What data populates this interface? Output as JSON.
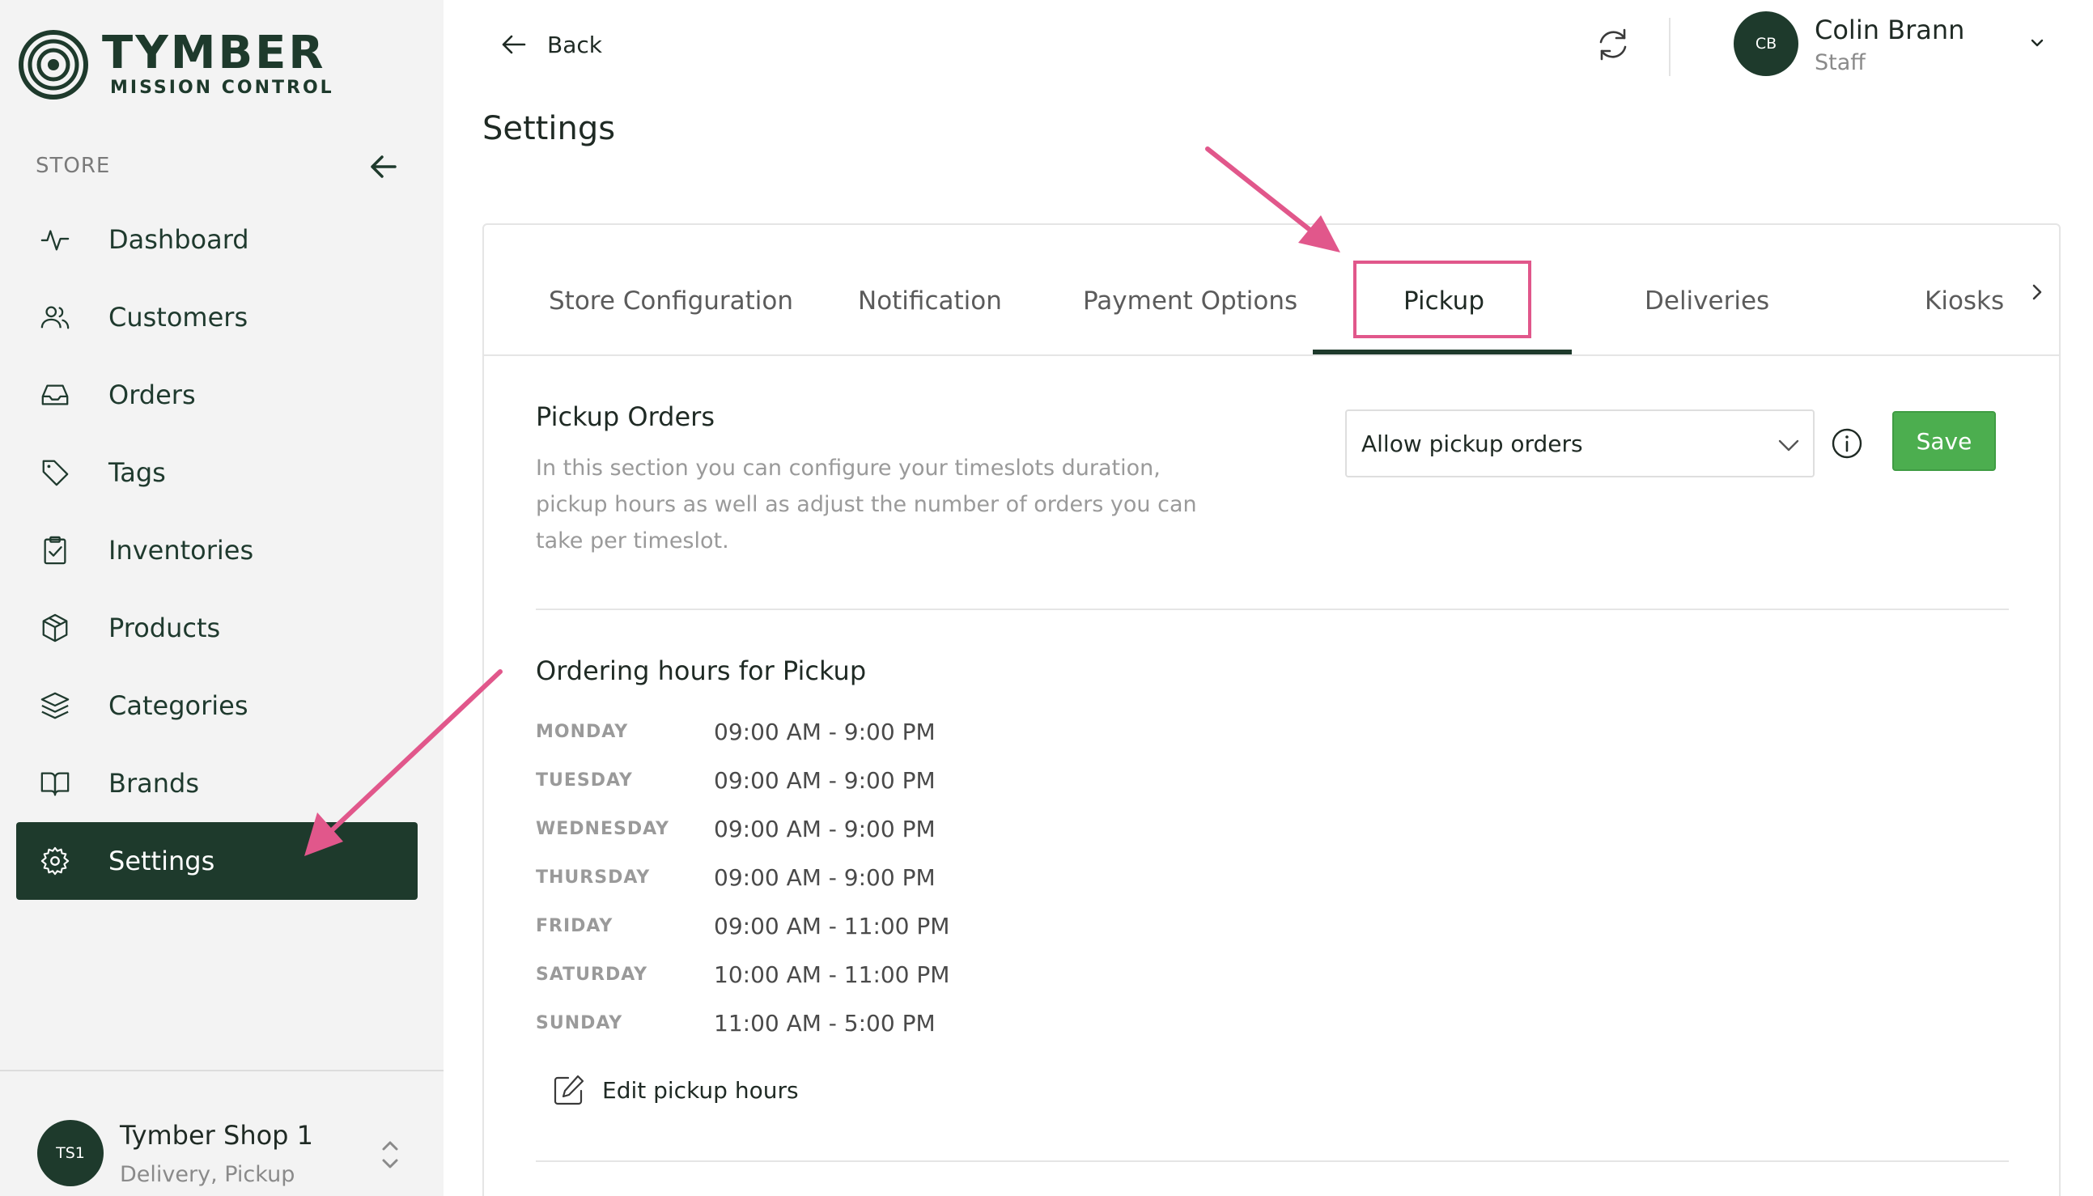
{
  "brand": {
    "title": "TYMBER",
    "subtitle": "MISSION CONTROL"
  },
  "sidebar": {
    "section_label": "STORE",
    "items": [
      {
        "label": "Dashboard",
        "icon": "activity-icon"
      },
      {
        "label": "Customers",
        "icon": "users-icon"
      },
      {
        "label": "Orders",
        "icon": "inbox-icon"
      },
      {
        "label": "Tags",
        "icon": "tag-icon"
      },
      {
        "label": "Inventories",
        "icon": "clipboard-check-icon"
      },
      {
        "label": "Products",
        "icon": "package-icon"
      },
      {
        "label": "Categories",
        "icon": "layers-icon"
      },
      {
        "label": "Brands",
        "icon": "book-open-icon"
      },
      {
        "label": "Settings",
        "icon": "gear-icon",
        "active": true
      }
    ],
    "shop": {
      "initials": "TS1",
      "name": "Tymber Shop 1",
      "subtitle": "Delivery, Pickup"
    }
  },
  "header": {
    "back_label": "Back",
    "user": {
      "initials": "CB",
      "name": "Colin Brann",
      "role": "Staff"
    }
  },
  "page": {
    "title": "Settings"
  },
  "tabs": [
    {
      "label": "Store Configuration"
    },
    {
      "label": "Notification"
    },
    {
      "label": "Payment Options"
    },
    {
      "label": "Pickup",
      "active": true
    },
    {
      "label": "Deliveries"
    },
    {
      "label": "Kiosks"
    }
  ],
  "pickup": {
    "title": "Pickup Orders",
    "description": "In this section you can configure your timeslots duration, pickup hours as well as adjust the number of orders you can take per timeslot.",
    "select_value": "Allow pickup orders",
    "save_label": "Save",
    "hours_title": "Ordering hours for Pickup",
    "hours": [
      {
        "day": "MONDAY",
        "time": "09:00 AM - 9:00 PM"
      },
      {
        "day": "TUESDAY",
        "time": "09:00 AM - 9:00 PM"
      },
      {
        "day": "WEDNESDAY",
        "time": "09:00 AM - 9:00 PM"
      },
      {
        "day": "THURSDAY",
        "time": "09:00 AM - 9:00 PM"
      },
      {
        "day": "FRIDAY",
        "time": "09:00 AM - 11:00 PM"
      },
      {
        "day": "SATURDAY",
        "time": "10:00 AM - 11:00 PM"
      },
      {
        "day": "SUNDAY",
        "time": "11:00 AM - 5:00 PM"
      }
    ],
    "edit_label": "Edit pickup hours"
  },
  "colors": {
    "primary_dark": "#1e3a2c",
    "save_green": "#4cae4f",
    "annotation_pink": "#e1578b"
  }
}
